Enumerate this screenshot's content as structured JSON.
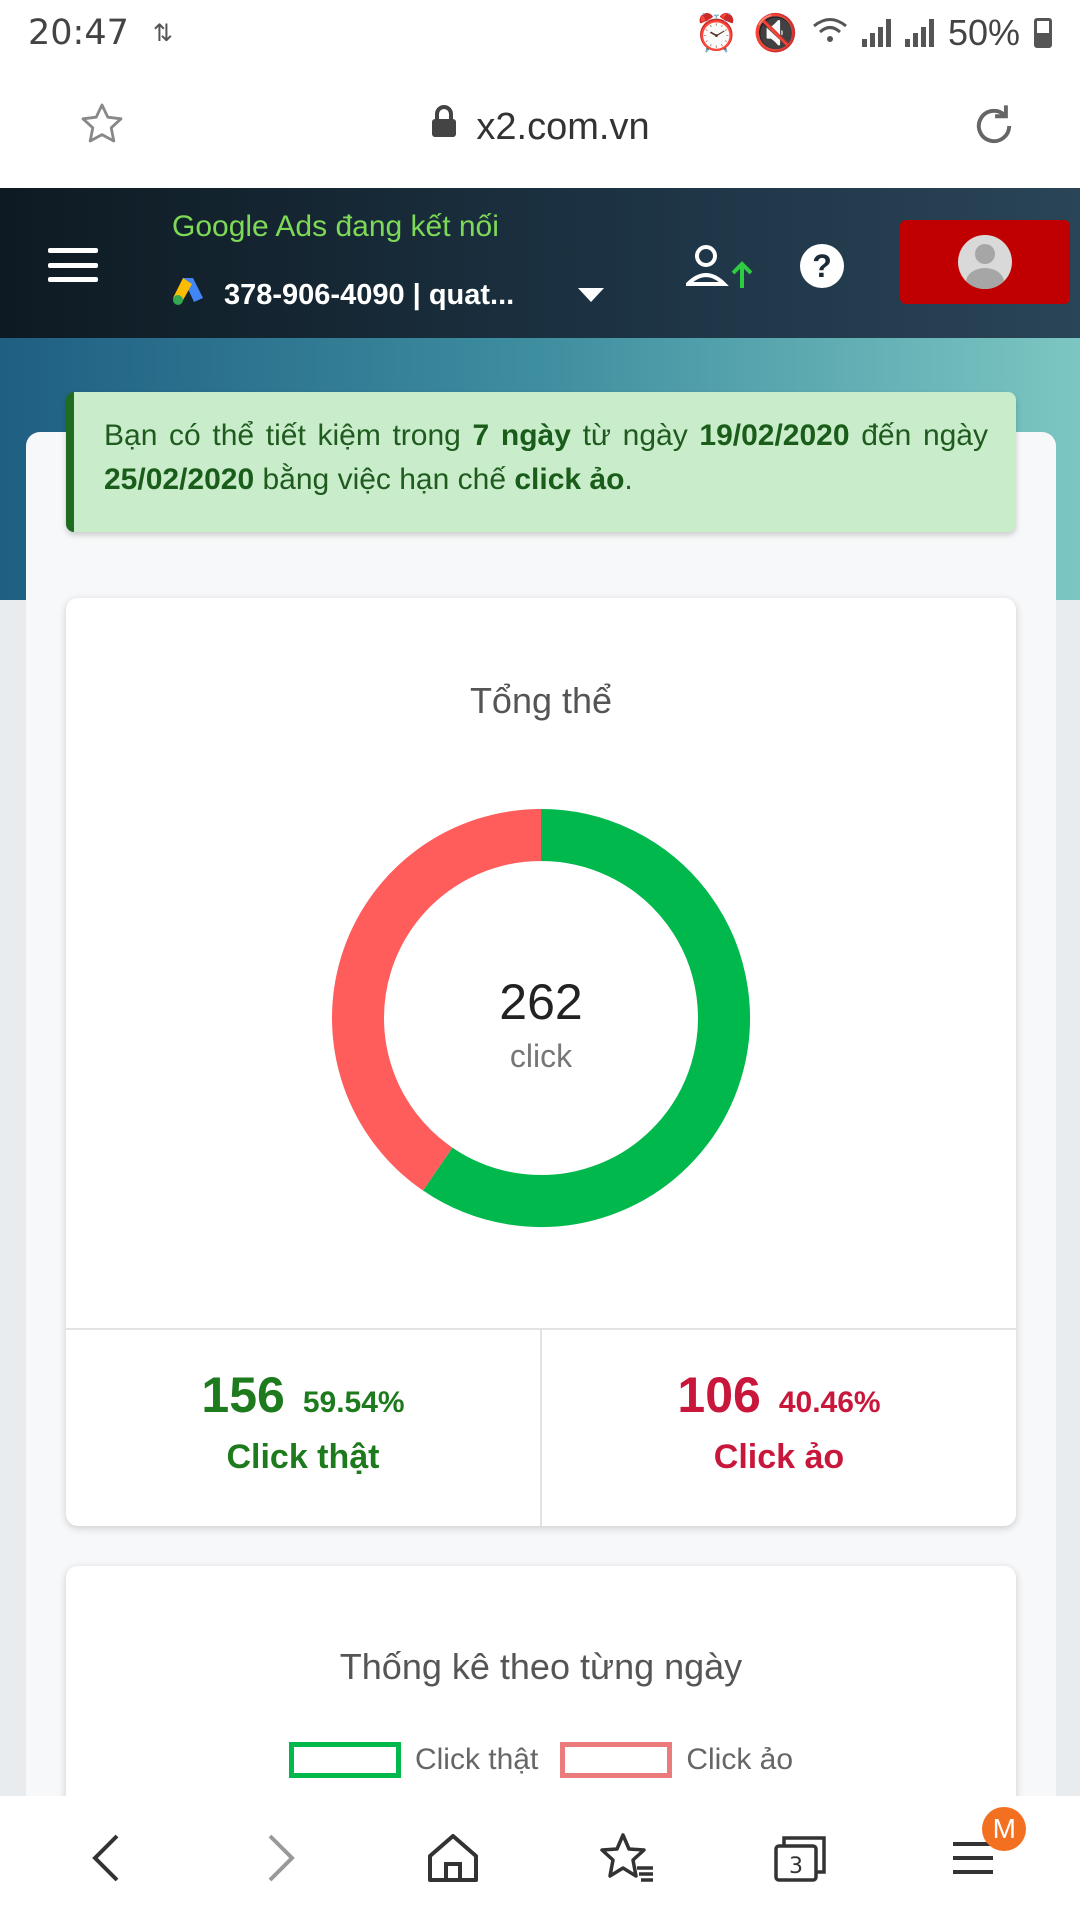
{
  "statusbar": {
    "time": "20:47",
    "battery": "50%"
  },
  "browser": {
    "url": "x2.com.vn",
    "tabs_count": "3",
    "menu_badge": "M"
  },
  "header": {
    "connection_status": "Google Ads đang kết nối",
    "account": "378-906-4090 | quat..."
  },
  "alert": {
    "t1": "Bạn có thể tiết kiệm trong ",
    "days": "7 ngày",
    "t2": " từ ngày ",
    "from": "19/02/2020",
    "t3": " đến ngày ",
    "to": "25/02/2020",
    "t4": " bằng việc hạn chế ",
    "clickfake": "click ảo",
    "t5": "."
  },
  "overview": {
    "title": "Tổng thể",
    "total": "262",
    "unit": "click",
    "real": {
      "count": "156",
      "percent": "59.54%",
      "label": "Click thật"
    },
    "fake": {
      "count": "106",
      "percent": "40.46%",
      "label": "Click ảo"
    }
  },
  "daily": {
    "title": "Thống kê theo từng ngày",
    "legend_real": "Click thật",
    "legend_fake": "Click ảo"
  },
  "colors": {
    "real": "#00b84c",
    "fake": "#ff5c5c",
    "header_bg": "#1a2a36",
    "profile_button": "#c00000"
  },
  "chart_data": {
    "type": "pie",
    "title": "Tổng thể",
    "categories": [
      "Click thật",
      "Click ảo"
    ],
    "values": [
      156,
      106
    ],
    "colors": [
      "#00b84c",
      "#ff5c5c"
    ]
  }
}
